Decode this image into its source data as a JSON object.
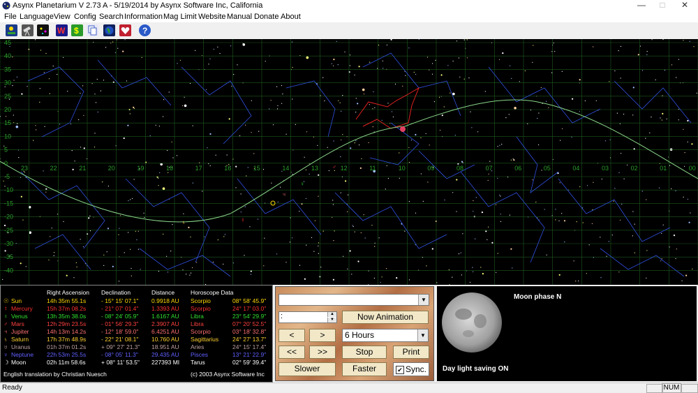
{
  "window": {
    "title": "Asynx Planetarium V 2.73 A - 5/19/2014 by Asynx Software Inc, California",
    "min_glyph": "—",
    "max_glyph": "□",
    "close_glyph": "✕"
  },
  "menu": [
    "File",
    "Language",
    "View",
    "Config",
    "Search",
    "Information",
    "Mag Limit",
    "Website",
    "Manual",
    "Donate",
    "About"
  ],
  "toolbar_icons": [
    "sky-view-icon",
    "telescope-icon",
    "star-icon",
    "w-icon",
    "dollar-icon",
    "copy-icon",
    "earth-icon",
    "heart-icon",
    "help-icon"
  ],
  "sky": {
    "dec_labels": [
      "45",
      "40",
      "35",
      "30",
      "25",
      "20",
      "15",
      "10",
      "5",
      "0",
      "-5",
      "-10",
      "-15",
      "-20",
      "-25",
      "-30",
      "-35",
      "-40"
    ],
    "ra_labels": [
      "23",
      "22",
      "21",
      "20",
      "19",
      "18",
      "17",
      "16",
      "15",
      "14",
      "13",
      "12",
      "11",
      "10",
      "09",
      "08",
      "07",
      "06",
      "05",
      "04",
      "03",
      "02",
      "01",
      "00"
    ]
  },
  "planets": {
    "headers": [
      "Right Ascension",
      "Declination",
      "Distance",
      "Horoscope Data"
    ],
    "rows": [
      {
        "name": "Sun",
        "symbol": "☉",
        "color": "#ffd800",
        "ra": "14h 35m 55.1s",
        "dec": "- 15° 15' 07.1\"",
        "dist": "0.9918 AU",
        "sign": "Scorpio",
        "deg": "08° 58' 45.9\""
      },
      {
        "name": "Mercury",
        "symbol": "☿",
        "color": "#ff3030",
        "ra": "15h 37m 08.2s",
        "dec": "- 21° 07' 01.4\"",
        "dist": "1.3393 AU",
        "sign": "Scorpio",
        "deg": "24° 17' 03.0\""
      },
      {
        "name": "Venus",
        "symbol": "♀",
        "color": "#30e030",
        "ra": "13h 35m 38.0s",
        "dec": "- 08° 24' 05.9\"",
        "dist": "1.6167 AU",
        "sign": "Libra",
        "deg": "23° 54' 29.9\""
      },
      {
        "name": "Mars",
        "symbol": "♂",
        "color": "#ff4040",
        "ra": "12h 29m 23.5s",
        "dec": "- 01° 56' 29.3\"",
        "dist": "2.3907 AU",
        "sign": "Libra",
        "deg": "07° 20' 52.5\""
      },
      {
        "name": "Jupiter",
        "symbol": "♃",
        "color": "#ff7070",
        "ra": "14h 13m 14.2s",
        "dec": "- 12° 18' 59.0\"",
        "dist": "6.4251 AU",
        "sign": "Scorpio",
        "deg": "03° 18' 32.8\""
      },
      {
        "name": "Saturn",
        "symbol": "♄",
        "color": "#ffd030",
        "ra": "17h 37m 48.9s",
        "dec": "- 22° 21' 08.1\"",
        "dist": "10.760 AU",
        "sign": "Sagittarius",
        "deg": "24° 27' 13.7\""
      },
      {
        "name": "Uranus",
        "symbol": "♅",
        "color": "#c0a0a0",
        "ra": "01h 37m 01.2s",
        "dec": "+ 09° 27' 21.3\"",
        "dist": "18.951 AU",
        "sign": "Aries",
        "deg": "24° 15' 17.4\""
      },
      {
        "name": "Neptune",
        "symbol": "♆",
        "color": "#6060ff",
        "ra": "22h 53m 25.5s",
        "dec": "- 08° 05' 11.3\"",
        "dist": "29.435 AU",
        "sign": "Pisces",
        "deg": "13° 21' 22.9\""
      },
      {
        "name": "Moon",
        "symbol": "☽",
        "color": "#ffffff",
        "ra": "02h 11m 58.6s",
        "dec": "+ 08° 11' 53.5\"",
        "dist": "227393 MI",
        "sign": "Tarus",
        "deg": "02° 59' 39.4\""
      }
    ],
    "translation_credit": "English translation by Christian Nuesch",
    "copyright": "(c) 2003 Asynx Software Inc"
  },
  "controls": {
    "dropdown_value": "",
    "time_value": ":",
    "now_animation": "Now Animation",
    "step_back": "<",
    "step_fwd": ">",
    "interval_value": "6 Hours",
    "fast_back": "<<",
    "fast_fwd": ">>",
    "stop": "Stop",
    "print": "Print",
    "slower": "Slower",
    "faster": "Faster",
    "sync_label": "Sync.",
    "sync_checked": true,
    "check_glyph": "✔"
  },
  "moon": {
    "phase_label": "Moon phase  N",
    "dst_label": "Day light saving ON"
  },
  "status": {
    "left": "Ready",
    "num": "NUM"
  }
}
